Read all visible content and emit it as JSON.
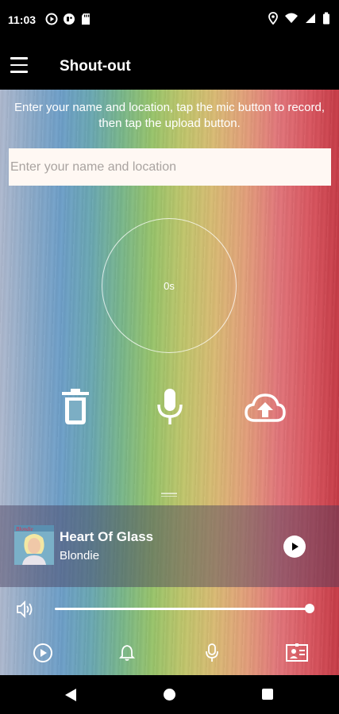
{
  "status_bar": {
    "time": "11:03",
    "left_icons": [
      "media-play-icon",
      "game-icon",
      "sd-card-icon"
    ],
    "right_icons": [
      "location-icon",
      "wifi-icon",
      "cellular-signal-icon",
      "battery-icon"
    ]
  },
  "app_bar": {
    "title": "Shout-out",
    "menu_icon": "hamburger-menu-icon"
  },
  "main": {
    "instructions": "Enter your name and location, tap the mic button to record, then tap the upload button.",
    "name_input": {
      "placeholder": "Enter your name and location",
      "value": ""
    },
    "timer": "0s",
    "controls": [
      "delete-icon",
      "microphone-icon",
      "cloud-upload-icon"
    ]
  },
  "now_playing": {
    "title": "Heart Of Glass",
    "artist": "Blondie",
    "album_art_text": "Blondie",
    "play_icon": "play-icon"
  },
  "volume": {
    "icon": "volume-icon",
    "level_percent": 100
  },
  "bottom_tabs": [
    "play-circle-icon",
    "bell-icon",
    "microphone-icon",
    "contact-card-icon"
  ],
  "colors": {
    "accent": "#ffffff",
    "input_background": "#fff8f3",
    "bar_background": "#000000"
  }
}
